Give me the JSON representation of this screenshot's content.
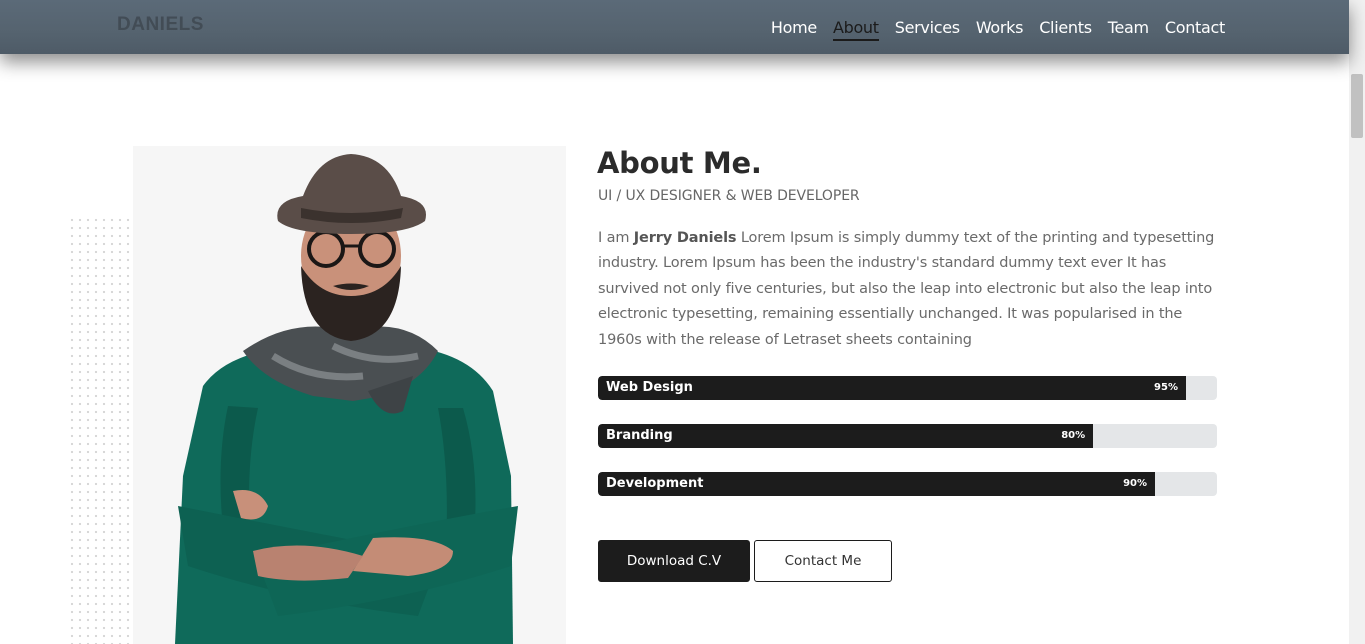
{
  "header": {
    "logo": "DANIELS",
    "nav": [
      "Home",
      "About",
      "Services",
      "Works",
      "Clients",
      "Team",
      "Contact"
    ],
    "active_nav": "About"
  },
  "about": {
    "title": "About Me.",
    "subtitle": "UI / UX DESIGNER & WEB DEVELOPER",
    "intro_prefix": "I am ",
    "name": "Jerry Daniels",
    "paragraph": " Lorem Ipsum is simply dummy text of the printing and typesetting industry. Lorem Ipsum has been the industry's standard dummy text ever It has survived not only five centuries, but also the leap into electronic but also the leap into electronic typesetting, remaining essentially unchanged. It was popularised in the 1960s with the release of Letraset sheets containing"
  },
  "skills": [
    {
      "name": "Web Design",
      "percent_label": "95%",
      "value": 95
    },
    {
      "name": "Branding",
      "percent_label": "80%",
      "value": 80
    },
    {
      "name": "Development",
      "percent_label": "90%",
      "value": 90
    }
  ],
  "buttons": {
    "download": "Download C.V",
    "contact": "Contact Me"
  },
  "colors": {
    "header_bg": "#55636f",
    "dark": "#1c1c1c",
    "bar_track": "#e4e6e8",
    "sweater": "#0f6a5a"
  }
}
